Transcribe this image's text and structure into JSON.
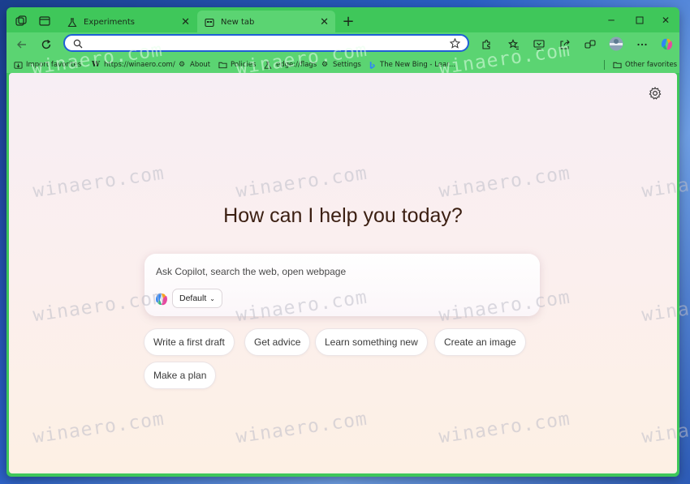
{
  "tabs": [
    {
      "title": "Experiments",
      "icon": "flask-icon",
      "active": false
    },
    {
      "title": "New tab",
      "icon": "new-tab-page-icon",
      "active": true
    }
  ],
  "addressbar": {
    "value": "",
    "placeholder": ""
  },
  "favorites": [
    {
      "label": "Import favorites",
      "icon": "import-icon"
    },
    {
      "label": "https://winaero.com/",
      "icon": "winaero-w-icon"
    },
    {
      "label": "About",
      "icon": "gear-icon"
    },
    {
      "label": "Policies",
      "icon": "folder-icon"
    },
    {
      "label": "edge://flags",
      "icon": "flask-icon"
    },
    {
      "label": "Settings",
      "icon": "gear-icon"
    },
    {
      "label": "The New Bing - Lear...",
      "icon": "bing-icon"
    }
  ],
  "other_favorites": "Other favorites",
  "headline": "How can I help you today?",
  "composer": {
    "placeholder": "Ask Copilot, search the web, open webpage",
    "mode": "Default"
  },
  "chips": [
    "Write a first draft",
    "Get advice",
    "Learn something new",
    "Create an image",
    "Make a plan"
  ],
  "watermark": "winaero.com",
  "colors": {
    "frame": "#3fc75a",
    "toolbar": "#5bd472",
    "address_border": "#1f5fd6",
    "headline": "#3b1f12"
  }
}
